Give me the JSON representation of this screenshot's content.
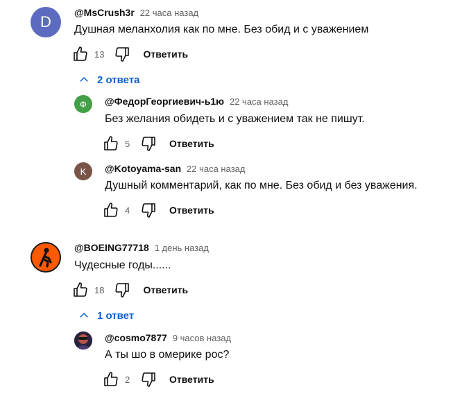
{
  "comments": [
    {
      "author": "@MsCrush3r",
      "time": "22 часа назад",
      "text": "Душная меланхолия как по мне. Без обид и с уважением",
      "likes": "13",
      "reply_label": "Ответить",
      "avatar_letter": "D",
      "avatar_color": "#5c6bc0",
      "replies_toggle": "2 ответа",
      "replies": [
        {
          "author": "@ФедорГеоргиевич-ь1ю",
          "time": "22 часа назад",
          "text": "Без желания обидеть и с уважением так не пишут.",
          "likes": "5",
          "reply_label": "Ответить",
          "avatar_letter": "Ф",
          "avatar_color": "#43a047"
        },
        {
          "author": "@Kotoyama-san",
          "time": "22 часа назад",
          "text": "Душный комментарий, как по мне. Без обид и без уважения.",
          "likes": "4",
          "reply_label": "Ответить",
          "avatar_letter": "K",
          "avatar_color": "#795548"
        }
      ]
    },
    {
      "author": "@BOEING77718",
      "time": "1 день назад",
      "text": "Чудесные годы......",
      "likes": "18",
      "reply_label": "Ответить",
      "avatar_color": "#ff5a00",
      "replies_toggle": "1 ответ",
      "replies": [
        {
          "author": "@cosmo7877",
          "time": "9 часов назад",
          "text": "А ты шо в омерике рос?",
          "likes": "2",
          "reply_label": "Ответить",
          "avatar_color": "#3a2b55"
        }
      ]
    }
  ],
  "colors": {
    "link_blue": "#065fd4",
    "secondary_text": "#606060"
  }
}
